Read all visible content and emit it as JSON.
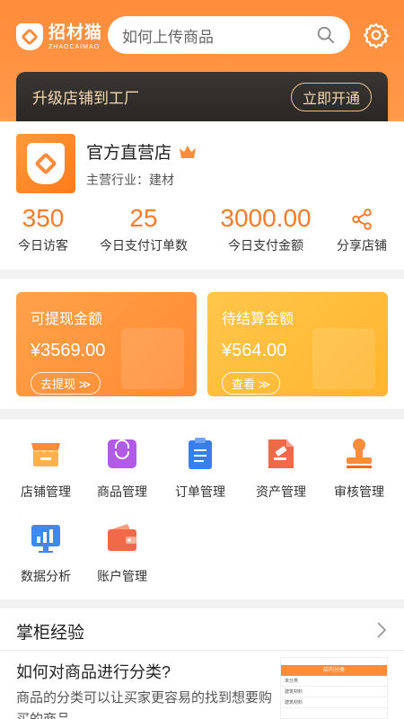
{
  "header": {
    "logo_cn": "招材猫",
    "logo_en": "ZHAOCAIMAO",
    "search_placeholder": "如何上传商品"
  },
  "banner": {
    "text": "升级店铺到工厂",
    "button": "立即开通"
  },
  "shop": {
    "name": "官方直营店",
    "industry": "主营行业：建材",
    "stats": [
      {
        "value": "350",
        "label": "今日访客"
      },
      {
        "value": "25",
        "label": "今日支付订单数"
      },
      {
        "value": "3000.00",
        "label": "今日支付金额"
      }
    ],
    "share_label": "分享店铺"
  },
  "cards": [
    {
      "title": "可提现金额",
      "amount": "¥3569.00",
      "button": "去提现 ≫"
    },
    {
      "title": "待结算金额",
      "amount": "¥564.00",
      "button": "查看 ≫"
    }
  ],
  "menu": [
    {
      "label": "店铺管理",
      "icon": "store-icon"
    },
    {
      "label": "商品管理",
      "icon": "bag-icon"
    },
    {
      "label": "订单管理",
      "icon": "clipboard-icon"
    },
    {
      "label": "资产管理",
      "icon": "gavel-icon"
    },
    {
      "label": "审核管理",
      "icon": "stamp-icon"
    },
    {
      "label": "数据分析",
      "icon": "chart-icon"
    },
    {
      "label": "账户管理",
      "icon": "wallet-icon"
    }
  ],
  "experience": {
    "section_title": "掌柜经验",
    "article_title": "如何对商品进行分类?",
    "article_body": "商品的分类可以让买家更容易的找到想要购买的商品",
    "thumb_header": "店内分类",
    "thumb_rows": [
      "未分类",
      "建筑材料",
      "建筑材料"
    ]
  },
  "colors": {
    "accent": "#ff8c3a",
    "gold": "#f5d9b0"
  }
}
